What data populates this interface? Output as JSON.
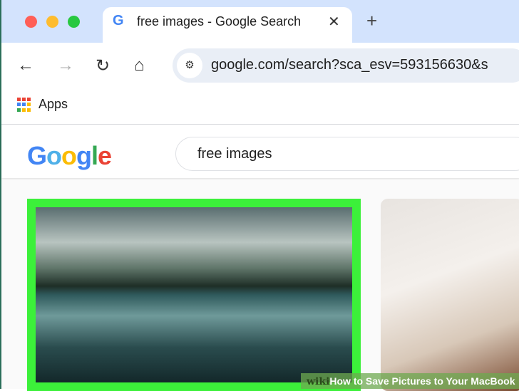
{
  "browser": {
    "tab": {
      "title": "free images - Google Search",
      "favicon": "G",
      "close": "✕"
    },
    "new_tab": "+",
    "url": "google.com/search?sca_esv=593156630&s",
    "bookmarks": [
      {
        "label": "Apps"
      }
    ],
    "window_controls": {
      "close": "#ff5f57",
      "minimize": "#febc2e",
      "maximize": "#28c840"
    }
  },
  "page": {
    "logo": "Google",
    "search_query": "free images"
  },
  "images": [
    {
      "selected": true,
      "highlight_color": "#3cf03a"
    },
    {
      "selected": false
    }
  ],
  "watermark": {
    "brand": "wiki",
    "text": "How to Save Pictures to Your MacBook"
  }
}
